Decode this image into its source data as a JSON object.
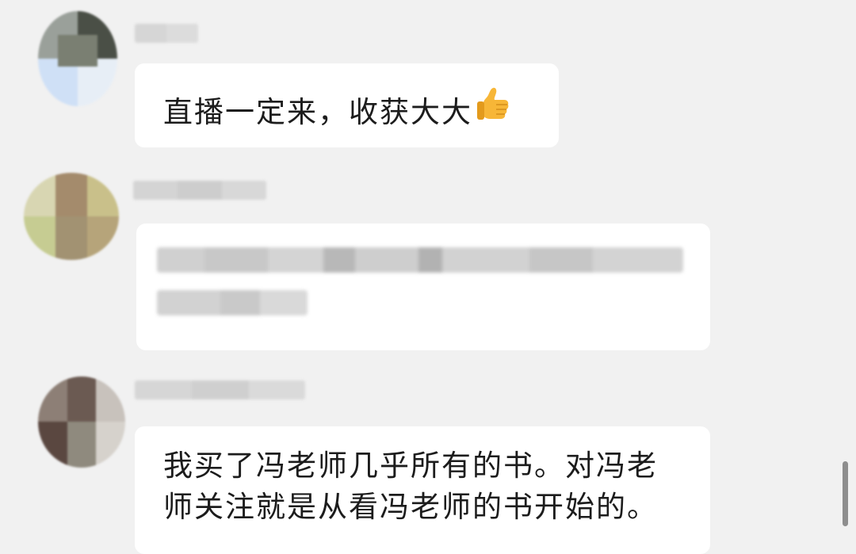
{
  "messages": [
    {
      "text": "直播一定来，收获大大",
      "emoji": "thumbs-up-icon"
    },
    {
      "text": ""
    },
    {
      "text": "我买了冯老师几乎所有的书。对冯老\n师关注就是从看冯老师的书开始的。"
    }
  ],
  "colors": {
    "background": "#f1f1f1",
    "bubble": "#ffffff",
    "text": "#1c1c1c",
    "scrollbar": "#8e8e8e"
  }
}
